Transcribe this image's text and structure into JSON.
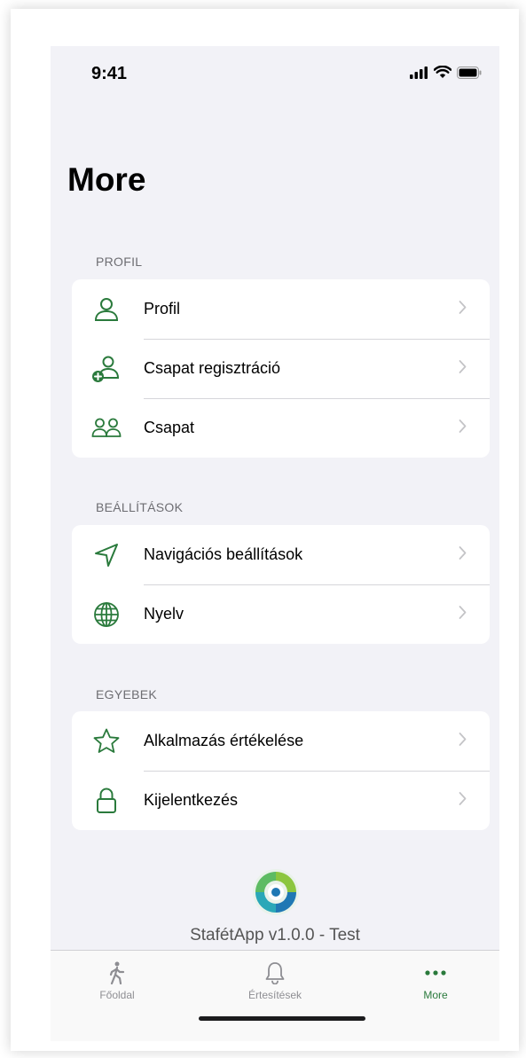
{
  "status_bar": {
    "time": "9:41"
  },
  "page": {
    "title": "More"
  },
  "sections": [
    {
      "header": "PROFIL",
      "items": [
        {
          "label": "Profil",
          "icon": "person-icon"
        },
        {
          "label": "Csapat regisztráció",
          "icon": "person-add-icon"
        },
        {
          "label": "Csapat",
          "icon": "people-icon"
        }
      ]
    },
    {
      "header": "BEÁLLÍTÁSOK",
      "items": [
        {
          "label": "Navigációs beállítások",
          "icon": "navigation-arrow-icon"
        },
        {
          "label": "Nyelv",
          "icon": "globe-icon"
        }
      ]
    },
    {
      "header": "EGYEBEK",
      "items": [
        {
          "label": "Alkalmazás értékelése",
          "icon": "star-icon"
        },
        {
          "label": "Kijelentkezés",
          "icon": "lock-icon"
        }
      ]
    }
  ],
  "footer": {
    "version": "StafétApp v1.0.0 - Test"
  },
  "tab_bar": {
    "tabs": [
      {
        "label": "Főoldal",
        "icon": "walking-person-icon",
        "active": false
      },
      {
        "label": "Értesítések",
        "icon": "bell-icon",
        "active": false
      },
      {
        "label": "More",
        "icon": "more-dots-icon",
        "active": true
      }
    ]
  },
  "colors": {
    "accent": "#2a7a3c",
    "background": "#f2f2f7",
    "card": "#ffffff",
    "section_header": "#6d6d72",
    "inactive_tab": "#8e8e93"
  }
}
